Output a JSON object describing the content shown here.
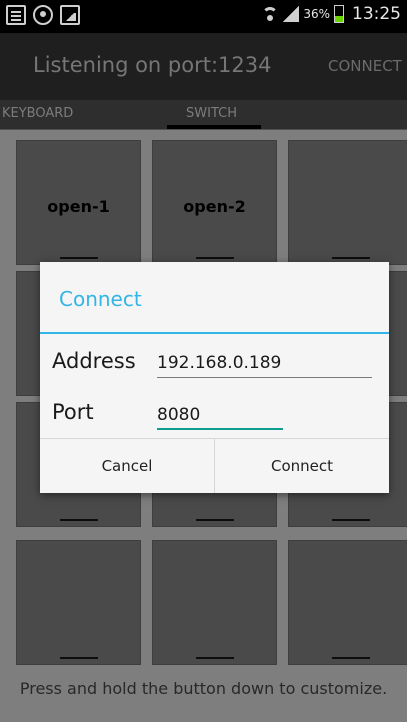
{
  "status_bar": {
    "left_icons": [
      "document-icon",
      "user-icon",
      "image-icon"
    ],
    "battery_text": "36%",
    "battery_level": 0.36,
    "battery_color": "#6bd400",
    "time": "13:25"
  },
  "action_bar": {
    "title": "Listening on port:1234",
    "connect_label": "CONNECT"
  },
  "tabs": [
    {
      "label": "KEYBOARD",
      "selected": false
    },
    {
      "label": "SWITCH",
      "selected": true
    }
  ],
  "grid": {
    "cells": [
      {
        "label": "open-1"
      },
      {
        "label": "open-2"
      },
      {
        "label": ""
      },
      {
        "label": ""
      },
      {
        "label": ""
      },
      {
        "label": ""
      },
      {
        "label": ""
      },
      {
        "label": ""
      },
      {
        "label": ""
      },
      {
        "label": ""
      },
      {
        "label": ""
      },
      {
        "label": ""
      }
    ]
  },
  "hint": "Press and hold the button down to customize.",
  "dialog": {
    "title": "Connect",
    "address_label": "Address",
    "address_value": "192.168.0.189",
    "port_label": "Port",
    "port_value": "8080",
    "cancel_label": "Cancel",
    "connect_label": "Connect",
    "accent_color": "#33b5e5"
  }
}
